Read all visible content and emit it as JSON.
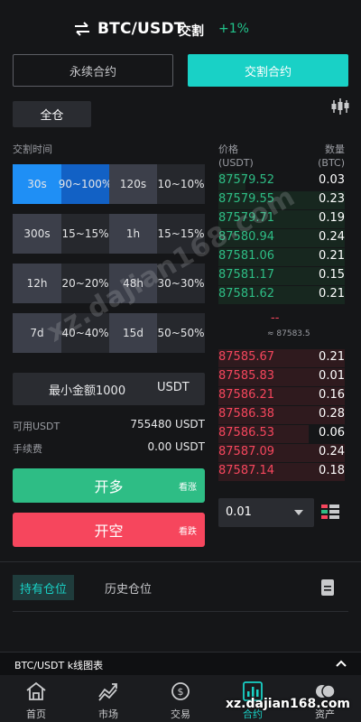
{
  "header": {
    "pair": "BTC/USDT",
    "type": "交割",
    "change": "+1%"
  },
  "tabs": {
    "perpetual": "永续合约",
    "delivery": "交割合约"
  },
  "margin_mode": "全仓",
  "delivery_time_label": "交割时间",
  "time_options": [
    {
      "time": "30s",
      "range": "90~100%",
      "selected": true
    },
    {
      "time": "120s",
      "range": "10~10%",
      "selected": false
    },
    {
      "time": "300s",
      "range": "15~15%",
      "selected": false
    },
    {
      "time": "1h",
      "range": "15~15%",
      "selected": false
    },
    {
      "time": "12h",
      "range": "20~20%",
      "selected": false
    },
    {
      "time": "48h",
      "range": "30~30%",
      "selected": false
    },
    {
      "time": "7d",
      "range": "40~40%",
      "selected": false
    },
    {
      "time": "15d",
      "range": "50~50%",
      "selected": false
    }
  ],
  "amount": {
    "placeholder": "最小金额1000",
    "unit": "USDT"
  },
  "available": {
    "label": "可用USDT",
    "value": "755480 USDT"
  },
  "fee": {
    "label": "手续费",
    "value": "0.00 USDT"
  },
  "buttons": {
    "long": {
      "label": "开多",
      "sub": "看涨"
    },
    "short": {
      "label": "开空",
      "sub": "看跌"
    }
  },
  "orderbook": {
    "price_header": "价格",
    "price_unit": "(USDT)",
    "qty_header": "数量",
    "qty_unit": "(BTC)",
    "bids": [
      {
        "price": "87579.52",
        "qty": "0.03"
      },
      {
        "price": "87579.55",
        "qty": "0.23"
      },
      {
        "price": "87579.71",
        "qty": "0.19"
      },
      {
        "price": "87580.94",
        "qty": "0.24"
      },
      {
        "price": "87581.06",
        "qty": "0.21"
      },
      {
        "price": "87581.17",
        "qty": "0.15"
      },
      {
        "price": "87581.62",
        "qty": "0.21"
      }
    ],
    "mid_price": "--",
    "mid_sub": "≈ 87583.5",
    "asks": [
      {
        "price": "87585.67",
        "qty": "0.21"
      },
      {
        "price": "87585.83",
        "qty": "0.01"
      },
      {
        "price": "87586.21",
        "qty": "0.16"
      },
      {
        "price": "87586.38",
        "qty": "0.28"
      },
      {
        "price": "87586.53",
        "qty": "0.06"
      },
      {
        "price": "87587.09",
        "qty": "0.24"
      },
      {
        "price": "87587.14",
        "qty": "0.18"
      }
    ],
    "precision": "0.01"
  },
  "positions": {
    "current": "持有仓位",
    "history": "历史仓位"
  },
  "chart_bar": {
    "label": "BTC/USDT k线图表"
  },
  "nav": [
    {
      "label": "首页",
      "icon": "home-icon"
    },
    {
      "label": "市场",
      "icon": "market-icon"
    },
    {
      "label": "交易",
      "icon": "trade-icon"
    },
    {
      "label": "合约",
      "icon": "contract-icon"
    },
    {
      "label": "资产",
      "icon": "assets-icon"
    }
  ],
  "watermark": "xz.dajian168.com",
  "watermark_bottom": "xz.dajian168.com",
  "colors": {
    "accent": "#19d1c6",
    "buy": "#2ebd85",
    "sell": "#f6465d",
    "selected": "#1f8ff5"
  }
}
